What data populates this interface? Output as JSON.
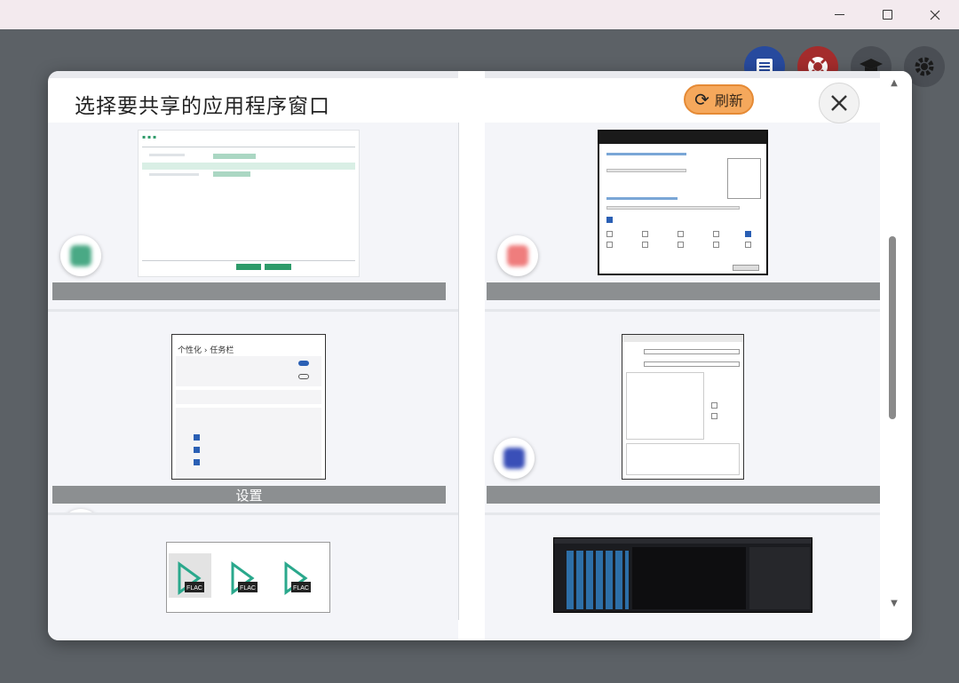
{
  "window": {
    "controls": {
      "minimize": "minimize",
      "maximize": "maximize",
      "close": "close"
    }
  },
  "background_toolbar": {
    "icons": [
      "list-icon",
      "lifebuoy-icon",
      "graduation-cap-icon",
      "gear-icon"
    ],
    "colors": {
      "list": "#274a9e",
      "help": "#a42c2c",
      "neutral": "#4a4e54"
    }
  },
  "dialog": {
    "title": "选择要共享的应用程序窗口",
    "refresh_label": "刷新",
    "refresh_color": "#f5a85c"
  },
  "windows": [
    {
      "label": "",
      "blurred": true
    },
    {
      "label": "",
      "blurred": true
    },
    {
      "label": "设置",
      "blurred": false
    },
    {
      "label": "",
      "blurred": true
    },
    {
      "label": "",
      "blurred": false
    },
    {
      "label": "",
      "blurred": false
    }
  ],
  "thumbs": {
    "settings": {
      "breadcrumb": "个性化 › 任务栏"
    },
    "flac": {
      "badge": "FLAC"
    }
  }
}
